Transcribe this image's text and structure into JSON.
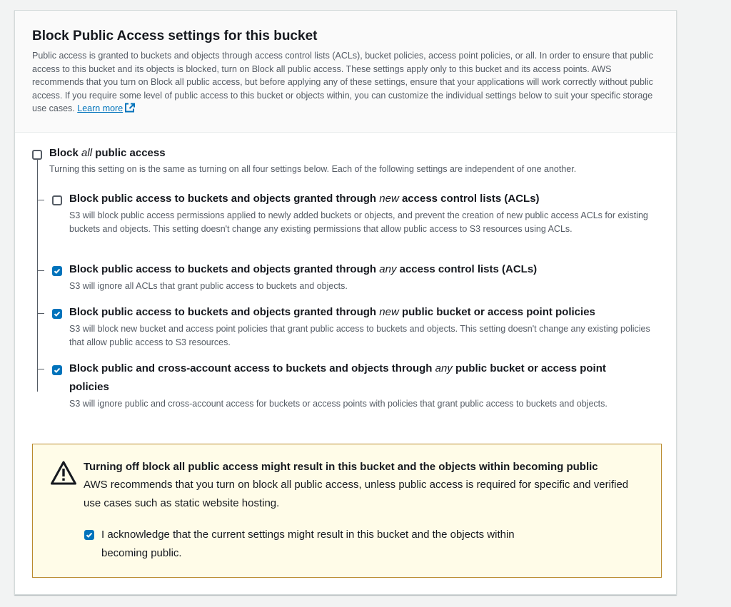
{
  "section": {
    "title": "Block Public Access settings for this bucket",
    "description": "Public access is granted to buckets and objects through access control lists (ACLs), bucket policies, access point policies, or all. In order to ensure that public access to this bucket and its objects is blocked, turn on Block all public access. These settings apply only to this bucket and its access points. AWS recommends that you turn on Block all public access, but before applying any of these settings, ensure that your applications will work correctly without public access. If you require some level of public access to this bucket or objects within, you can customize the individual settings below to suit your specific storage use cases.",
    "learn_more": "Learn more",
    "icon": "external-link-icon"
  },
  "block_all": {
    "title_before": "Block ",
    "title_emph": "all",
    "title_after": " public access",
    "description": "Turning this setting on is the same as turning on all four settings below. Each of the following settings are independent of one another.",
    "checked": false
  },
  "options": [
    {
      "title_before": "Block public access to buckets and objects granted through ",
      "title_emph": "new",
      "title_after": " access control lists (ACLs)",
      "description": "S3 will block public access permissions applied to newly added buckets or objects, and prevent the creation of new public access ACLs for existing buckets and objects. This setting doesn't change any existing permissions that allow public access to S3 resources using ACLs.",
      "checked": false
    },
    {
      "title_before": "Block public access to buckets and objects granted through ",
      "title_emph": "any",
      "title_after": " access control lists (ACLs)",
      "description": "S3 will ignore all ACLs that grant public access to buckets and objects.",
      "checked": true
    },
    {
      "title_before": "Block public access to buckets and objects granted through ",
      "title_emph": "new",
      "title_after": " public bucket or access point policies",
      "description": "S3 will block new bucket and access point policies that grant public access to buckets and objects. This setting doesn't change any existing policies that allow public access to S3 resources.",
      "checked": true
    },
    {
      "title_before": "Block public and cross-account access to buckets and objects through ",
      "title_emph": "any",
      "title_after": " public bucket or access point policies",
      "description": "S3 will ignore public and cross-account access for buckets or access points with policies that grant public access to buckets and objects.",
      "checked": true
    }
  ],
  "warning": {
    "icon": "warning-triangle-icon",
    "title": "Turning off block all public access might result in this bucket and the objects within becoming public",
    "text": "AWS recommends that you turn on block all public access, unless public access is required for specific and verified use cases such as static website hosting.",
    "acknowledge": "I acknowledge that the current settings might result in this bucket and the objects within becoming public.",
    "acknowledge_checked": true
  },
  "colors": {
    "accent": "#0073bb",
    "warning_border": "#ba8a2c",
    "warning_bg": "#fffce8",
    "text_secondary": "#545b64"
  }
}
